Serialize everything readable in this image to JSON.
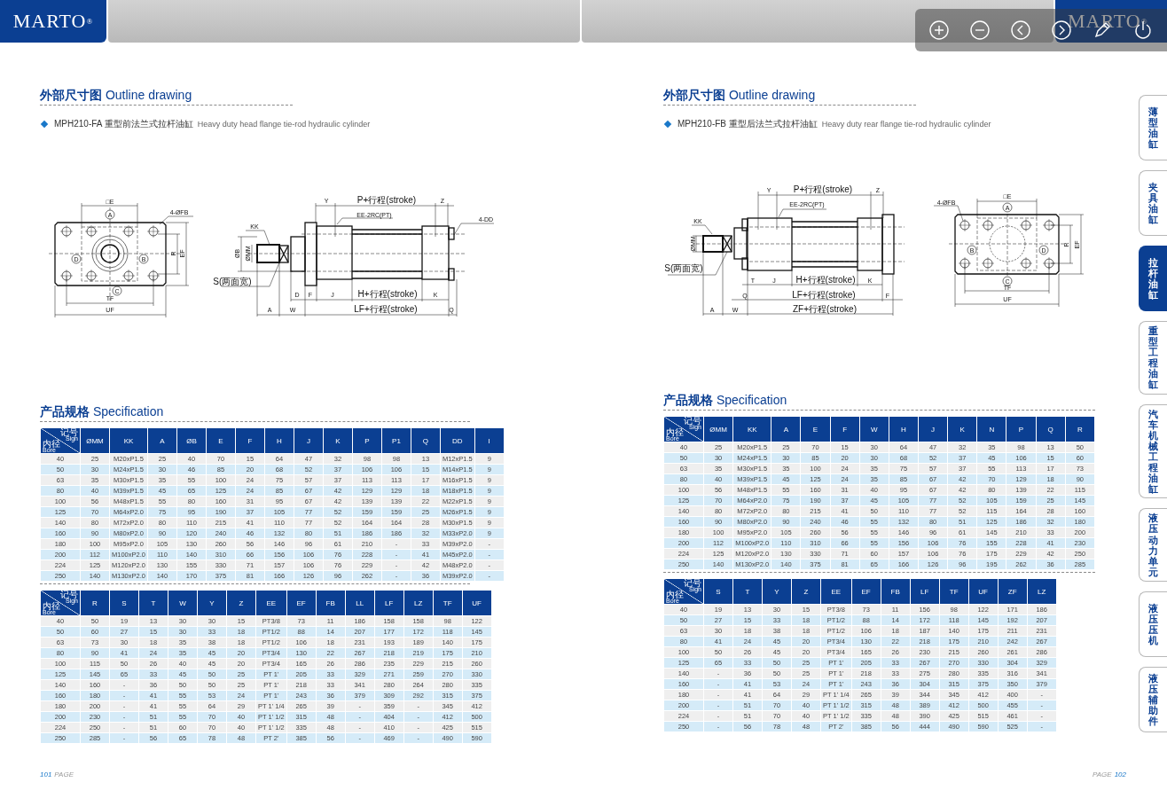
{
  "header": {
    "logo": "MARTO$^{®}$",
    "logo_right": "MARTO$^{®}$"
  },
  "toolbar": [
    {
      "kind": "zoom-in"
    },
    {
      "kind": "zoom-out"
    },
    {
      "kind": "previous"
    },
    {
      "kind": "next"
    },
    {
      "kind": "pen"
    },
    {
      "kind": "power"
    }
  ],
  "pages": [
    {
      "section_title": "**外部尺寸图** Outline drawing",
      "model": "MPH210-FA 重型前法兰式拉杆油缸",
      "model_en": "Heavy duty head flange tie-rod hydraulic cylinder",
      "drawing": {
        "labels": [
          "□E",
          "A",
          "4-ØFB",
          "D",
          "B",
          "R",
          "EF",
          "C",
          "TF",
          "UF",
          "Y",
          "P+行程(stroke)",
          "Z",
          "EE-2RC(PT)",
          "4-DD",
          "KK",
          "ØB",
          "ØMM",
          "S(两面宽)",
          "D",
          "F",
          "J",
          "H+行程(stroke)",
          "K",
          "A",
          "W",
          "LF+行程(stroke)",
          "Q"
        ]
      },
      "spec_title": "**产品规格** Specification",
      "tables": [
        {
          "columns": [
            {
              "kind": "corner",
              "sign": "记号",
              "sign_en": "Sign",
              "bore": "内径",
              "bore_en": "Bore"
            },
            "ØMM",
            "KK",
            "A",
            "ØB",
            "E",
            "F",
            "H",
            "J",
            "K",
            "P",
            "P1",
            "Q",
            "DD",
            "I"
          ],
          "rows": [
            [
              "40",
              "25",
              "M20xP1.5",
              "25",
              "40",
              "70",
              "15",
              "64",
              "47",
              "32",
              "98",
              "98",
              "13",
              "M12xP1.5",
              "9"
            ],
            [
              "50",
              "30",
              "M24xP1.5",
              "30",
              "46",
              "85",
              "20",
              "68",
              "52",
              "37",
              "106",
              "106",
              "15",
              "M14xP1.5",
              "9"
            ],
            [
              "63",
              "35",
              "M30xP1.5",
              "35",
              "55",
              "100",
              "24",
              "75",
              "57",
              "37",
              "113",
              "113",
              "17",
              "M16xP1.5",
              "9"
            ],
            [
              "80",
              "40",
              "M39xP1.5",
              "45",
              "65",
              "125",
              "24",
              "85",
              "67",
              "42",
              "129",
              "129",
              "18",
              "M18xP1.5",
              "9"
            ],
            [
              "100",
              "56",
              "M48xP1.5",
              "55",
              "80",
              "160",
              "31",
              "95",
              "67",
              "42",
              "139",
              "139",
              "22",
              "M22xP1.5",
              "9"
            ],
            [
              "125",
              "70",
              "M64xP2.0",
              "75",
              "95",
              "190",
              "37",
              "105",
              "77",
              "52",
              "159",
              "159",
              "25",
              "M26xP1.5",
              "9"
            ],
            [
              "140",
              "80",
              "M72xP2.0",
              "80",
              "110",
              "215",
              "41",
              "110",
              "77",
              "52",
              "164",
              "164",
              "28",
              "M30xP1.5",
              "9"
            ],
            [
              "160",
              "90",
              "M80xP2.0",
              "90",
              "120",
              "240",
              "46",
              "132",
              "80",
              "51",
              "186",
              "186",
              "32",
              "M33xP2.0",
              "9"
            ],
            [
              "180",
              "100",
              "M95xP2.0",
              "105",
              "130",
              "260",
              "56",
              "146",
              "96",
              "61",
              "210",
              "-",
              "33",
              "M39xP2.0",
              "-"
            ],
            [
              "200",
              "112",
              "M100xP2.0",
              "110",
              "140",
              "310",
              "66",
              "156",
              "106",
              "76",
              "228",
              "-",
              "41",
              "M45xP2.0",
              "-"
            ],
            [
              "224",
              "125",
              "M120xP2.0",
              "130",
              "155",
              "330",
              "71",
              "157",
              "106",
              "76",
              "229",
              "-",
              "42",
              "M48xP2.0",
              "-"
            ],
            [
              "250",
              "140",
              "M130xP2.0",
              "140",
              "170",
              "375",
              "81",
              "166",
              "126",
              "96",
              "262",
              "-",
              "36",
              "M39xP2.0",
              "-"
            ]
          ]
        },
        {
          "columns": [
            {
              "kind": "corner",
              "sign": "记号",
              "sign_en": "Sign",
              "bore": "内径",
              "bore_en": "Bore"
            },
            "R",
            "S",
            "T",
            "W",
            "Y",
            "Z",
            "EE",
            "EF",
            "FB",
            "LL",
            "LF",
            "LZ",
            "TF",
            "UF"
          ],
          "rows": [
            [
              "40",
              "50",
              "19",
              "13",
              "30",
              "30",
              "15",
              "PT3/8",
              "73",
              "11",
              "186",
              "158",
              "158",
              "98",
              "122"
            ],
            [
              "50",
              "60",
              "27",
              "15",
              "30",
              "33",
              "18",
              "PT1/2",
              "88",
              "14",
              "207",
              "177",
              "172",
              "118",
              "145"
            ],
            [
              "63",
              "73",
              "30",
              "18",
              "35",
              "38",
              "18",
              "PT1/2",
              "106",
              "18",
              "231",
              "193",
              "189",
              "140",
              "175"
            ],
            [
              "80",
              "90",
              "41",
              "24",
              "35",
              "45",
              "20",
              "PT3/4",
              "130",
              "22",
              "267",
              "218",
              "219",
              "175",
              "210"
            ],
            [
              "100",
              "115",
              "50",
              "26",
              "40",
              "45",
              "20",
              "PT3/4",
              "165",
              "26",
              "286",
              "235",
              "229",
              "215",
              "260"
            ],
            [
              "125",
              "145",
              "65",
              "33",
              "45",
              "50",
              "25",
              "PT 1'",
              "205",
              "33",
              "329",
              "271",
              "259",
              "270",
              "330"
            ],
            [
              "140",
              "160",
              "-",
              "36",
              "50",
              "50",
              "25",
              "PT 1'",
              "218",
              "33",
              "341",
              "280",
              "264",
              "280",
              "335"
            ],
            [
              "160",
              "180",
              "-",
              "41",
              "55",
              "53",
              "24",
              "PT 1'",
              "243",
              "36",
              "379",
              "309",
              "292",
              "315",
              "375"
            ],
            [
              "180",
              "200",
              "-",
              "41",
              "55",
              "64",
              "29",
              "PT 1' 1/4",
              "265",
              "39",
              "-",
              "359",
              "-",
              "345",
              "412"
            ],
            [
              "200",
              "230",
              "-",
              "51",
              "55",
              "70",
              "40",
              "PT 1' 1/2",
              "315",
              "48",
              "-",
              "404",
              "-",
              "412",
              "500"
            ],
            [
              "224",
              "250",
              "-",
              "51",
              "60",
              "70",
              "40",
              "PT 1' 1/2",
              "335",
              "48",
              "-",
              "410",
              "-",
              "425",
              "515"
            ],
            [
              "250",
              "285",
              "-",
              "56",
              "65",
              "78",
              "48",
              "PT 2'",
              "385",
              "56",
              "-",
              "469",
              "-",
              "490",
              "590"
            ]
          ]
        }
      ],
      "footer": [
        {
          "kind": "number",
          "text": "101"
        },
        {
          "kind": "word",
          "text": "PAGE"
        }
      ]
    },
    {
      "section_title": "**外部尺寸图** Outline drawing",
      "model": "MPH210-FB 重型后法兰式拉杆油缸",
      "model_en": "Heavy duty rear flange tie-rod hydraulic cylinder",
      "drawing": {
        "labels": [
          "Y",
          "P+行程(stroke)",
          "Z",
          "EE-2RC(PT)",
          "KK",
          "ØMM",
          "S(两面宽)",
          "T",
          "J",
          "H+行程(stroke)",
          "K",
          "Q",
          "LF+行程(stroke)",
          "F",
          "A",
          "W",
          "ZF+行程(stroke)",
          "□E",
          "4-ØFB",
          "A",
          "B",
          "D",
          "R",
          "EF",
          "C",
          "TF",
          "UF"
        ]
      },
      "spec_title": "**产品规格** Specification",
      "tables": [
        {
          "columns": [
            {
              "kind": "corner",
              "sign": "记号",
              "sign_en": "Sign",
              "bore": "内径",
              "bore_en": "Bore"
            },
            "ØMM",
            "KK",
            "A",
            "E",
            "F",
            "W",
            "H",
            "J",
            "K",
            "N",
            "P",
            "Q",
            "R"
          ],
          "rows": [
            [
              "40",
              "25",
              "M20xP1.5",
              "25",
              "70",
              "15",
              "30",
              "64",
              "47",
              "32",
              "35",
              "98",
              "13",
              "50"
            ],
            [
              "50",
              "30",
              "M24xP1.5",
              "30",
              "85",
              "20",
              "30",
              "68",
              "52",
              "37",
              "45",
              "106",
              "15",
              "60"
            ],
            [
              "63",
              "35",
              "M30xP1.5",
              "35",
              "100",
              "24",
              "35",
              "75",
              "57",
              "37",
              "55",
              "113",
              "17",
              "73"
            ],
            [
              "80",
              "40",
              "M39xP1.5",
              "45",
              "125",
              "24",
              "35",
              "85",
              "67",
              "42",
              "70",
              "129",
              "18",
              "90"
            ],
            [
              "100",
              "56",
              "M48xP1.5",
              "55",
              "160",
              "31",
              "40",
              "95",
              "67",
              "42",
              "80",
              "139",
              "22",
              "115"
            ],
            [
              "125",
              "70",
              "M64xP2.0",
              "75",
              "190",
              "37",
              "45",
              "105",
              "77",
              "52",
              "105",
              "159",
              "25",
              "145"
            ],
            [
              "140",
              "80",
              "M72xP2.0",
              "80",
              "215",
              "41",
              "50",
              "110",
              "77",
              "52",
              "115",
              "164",
              "28",
              "160"
            ],
            [
              "160",
              "90",
              "M80xP2.0",
              "90",
              "240",
              "46",
              "55",
              "132",
              "80",
              "51",
              "125",
              "186",
              "32",
              "180"
            ],
            [
              "180",
              "100",
              "M95xP2.0",
              "105",
              "260",
              "56",
              "55",
              "146",
              "96",
              "61",
              "145",
              "210",
              "33",
              "200"
            ],
            [
              "200",
              "112",
              "M100xP2.0",
              "110",
              "310",
              "66",
              "55",
              "156",
              "106",
              "76",
              "155",
              "228",
              "41",
              "230"
            ],
            [
              "224",
              "125",
              "M120xP2.0",
              "130",
              "330",
              "71",
              "60",
              "157",
              "106",
              "76",
              "175",
              "229",
              "42",
              "250"
            ],
            [
              "250",
              "140",
              "M130xP2.0",
              "140",
              "375",
              "81",
              "65",
              "166",
              "126",
              "96",
              "195",
              "262",
              "36",
              "285"
            ]
          ]
        },
        {
          "columns": [
            {
              "kind": "corner",
              "sign": "记号",
              "sign_en": "Sign",
              "bore": "内径",
              "bore_en": "Bore"
            },
            "S",
            "T",
            "Y",
            "Z",
            "EE",
            "EF",
            "FB",
            "LF",
            "TF",
            "UF",
            "ZF",
            "LZ"
          ],
          "rows": [
            [
              "40",
              "19",
              "13",
              "30",
              "15",
              "PT3/8",
              "73",
              "11",
              "156",
              "98",
              "122",
              "171",
              "186"
            ],
            [
              "50",
              "27",
              "15",
              "33",
              "18",
              "PT1/2",
              "88",
              "14",
              "172",
              "118",
              "145",
              "192",
              "207"
            ],
            [
              "63",
              "30",
              "18",
              "38",
              "18",
              "PT1/2",
              "106",
              "18",
              "187",
              "140",
              "175",
              "211",
              "231"
            ],
            [
              "80",
              "41",
              "24",
              "45",
              "20",
              "PT3/4",
              "130",
              "22",
              "218",
              "175",
              "210",
              "242",
              "267"
            ],
            [
              "100",
              "50",
              "26",
              "45",
              "20",
              "PT3/4",
              "165",
              "26",
              "230",
              "215",
              "260",
              "261",
              "286"
            ],
            [
              "125",
              "65",
              "33",
              "50",
              "25",
              "PT 1'",
              "205",
              "33",
              "267",
              "270",
              "330",
              "304",
              "329"
            ],
            [
              "140",
              "-",
              "36",
              "50",
              "25",
              "PT 1'",
              "218",
              "33",
              "275",
              "280",
              "335",
              "316",
              "341"
            ],
            [
              "160",
              "-",
              "41",
              "53",
              "24",
              "PT 1'",
              "243",
              "36",
              "304",
              "315",
              "375",
              "350",
              "379"
            ],
            [
              "180",
              "-",
              "41",
              "64",
              "29",
              "PT 1' 1/4",
              "265",
              "39",
              "344",
              "345",
              "412",
              "400",
              "-"
            ],
            [
              "200",
              "-",
              "51",
              "70",
              "40",
              "PT 1' 1/2",
              "315",
              "48",
              "389",
              "412",
              "500",
              "455",
              "-"
            ],
            [
              "224",
              "-",
              "51",
              "70",
              "40",
              "PT 1' 1/2",
              "335",
              "48",
              "390",
              "425",
              "515",
              "461",
              "-"
            ],
            [
              "250",
              "-",
              "56",
              "78",
              "48",
              "PT 2'",
              "385",
              "56",
              "444",
              "490",
              "590",
              "525",
              "-"
            ]
          ]
        }
      ],
      "footer": [
        {
          "kind": "word",
          "text": "PAGE"
        },
        {
          "kind": "number",
          "text": "102"
        }
      ]
    }
  ],
  "sidebar": {
    "items": [
      {
        "label": "薄型油缸",
        "selected": false
      },
      {
        "label": "夹具油缸",
        "selected": false
      },
      {
        "label": "拉杆油缸",
        "selected": true
      },
      {
        "label": "重型工程油缸",
        "selected": false
      },
      {
        "label": "汽车机械工程油缸",
        "selected": false
      },
      {
        "label": "液压动力单元",
        "selected": false
      },
      {
        "label": "液压压机",
        "selected": false
      },
      {
        "label": "液压辅助件",
        "selected": false
      }
    ]
  }
}
